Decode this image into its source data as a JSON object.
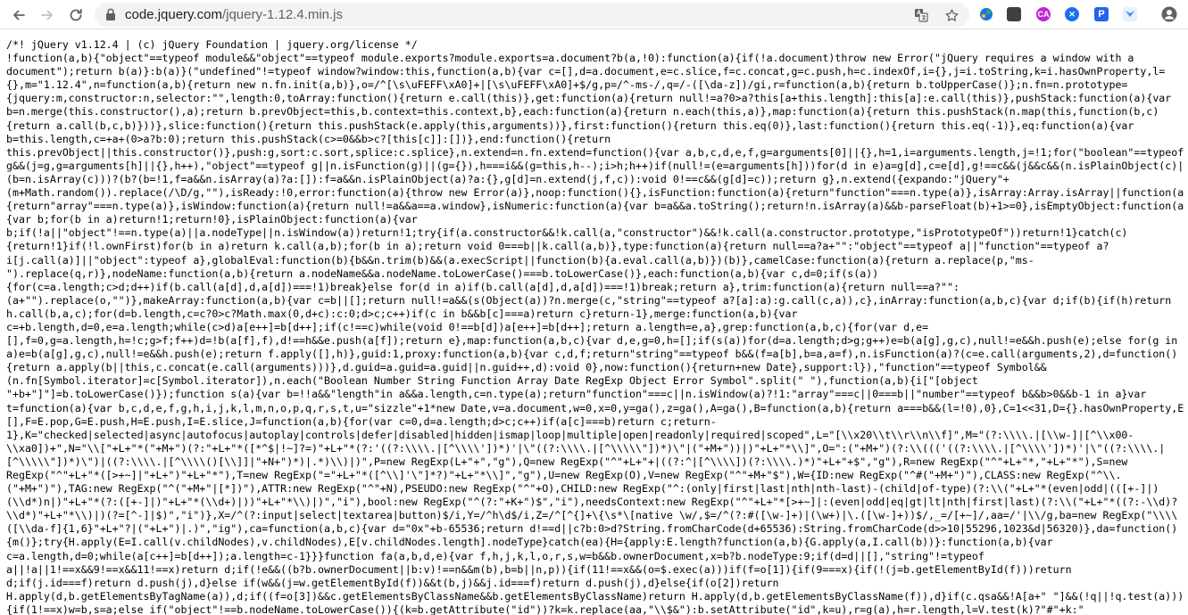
{
  "browser": {
    "url_host": "code.jquery.com",
    "url_path": "/jquery-1.12.4.min.js",
    "extensions": [
      {
        "name": "ext-colorpicker",
        "color": "#1a73e8",
        "label": ""
      },
      {
        "name": "ext-dark",
        "color": "#3c4043",
        "label": ""
      },
      {
        "name": "ext-ca",
        "color": "#c026d3",
        "label": "CA"
      },
      {
        "name": "ext-x",
        "color": "#1a73e8",
        "label": "✕"
      },
      {
        "name": "ext-p",
        "color": "#2563eb",
        "label": "P"
      },
      {
        "name": "ext-bird",
        "color": "#e8f0fe",
        "label": ""
      }
    ]
  },
  "code": {
    "lines": [
      "/*! jQuery v1.12.4 | (c) jQuery Foundation | jquery.org/license */",
      "!function(a,b){\"object\"==typeof module&&\"object\"==typeof module.exports?module.exports=a.document?b(a,!0):function(a){if(!a.document)throw new Error(\"jQuery requires a window with a",
      "document\");return b(a)}:b(a)}(\"undefined\"!=typeof window?window:this,function(a,b){var c=[],d=a.document,e=c.slice,f=c.concat,g=c.push,h=c.indexOf,i={},j=i.toString,k=i.hasOwnProperty,l=",
      "{},m=\"1.12.4\",n=function(a,b){return new n.fn.init(a,b)},o=/^[\\s\\uFEFF\\xA0]+|[\\s\\uFEFF\\xA0]+$/g,p=/^-ms-/,q=/-([\\da-z])/gi,r=function(a,b){return b.toUpperCase()};n.fn=n.prototype=",
      "{jquery:m,constructor:n,selector:\"\",length:0,toArray:function(){return e.call(this)},get:function(a){return null!=a?0>a?this[a+this.length]:this[a]:e.call(this)},pushStack:function(a){var",
      "b=n.merge(this.constructor(),a);return b.prevObject=this,b.context=this.context,b},each:function(a){return n.each(this,a)},map:function(a){return this.pushStack(n.map(this,function(b,c)",
      "{return a.call(b,c,b)}))},slice:function(){return this.pushStack(e.apply(this,arguments))},first:function(){return this.eq(0)},last:function(){return this.eq(-1)},eq:function(a){var",
      "b=this.length,c=+a+(0>a?b:0);return this.pushStack(c>=0&&b>c?[this[c]]:[])},end:function(){return",
      "this.prevObject||this.constructor()},push:g,sort:c.sort,splice:c.splice},n.extend=n.fn.extend=function(){var a,b,c,d,e,f,g=arguments[0]||{},h=1,i=arguments.length,j=!1;for(\"boolean\"==typeof",
      "g&&(j=g,g=arguments[h]||{},h++),\"object\"==typeof g||n.isFunction(g)||(g={}),h===i&&(g=this,h--);i>h;h++)if(null!=(e=arguments[h]))for(d in e)a=g[d],c=e[d],g!==c&&(j&&c&&(n.isPlainObject(c)|",
      "(b=n.isArray(c)))?(b?(b=!1,f=a&&n.isArray(a)?a:[]):f=a&&n.isPlainObject(a)?a:{},g[d]=n.extend(j,f,c)):void 0!==c&&(g[d]=c));return g},n.extend({expando:\"jQuery\"+",
      "(m+Math.random()).replace(/\\D/g,\"\"),isReady:!0,error:function(a){throw new Error(a)},noop:function(){},isFunction:function(a){return\"function\"===n.type(a)},isArray:Array.isArray||function(a)",
      "{return\"array\"===n.type(a)},isWindow:function(a){return null!=a&&a==a.window},isNumeric:function(a){var b=a&&a.toString();return!n.isArray(a)&&b-parseFloat(b)+1>=0},isEmptyObject:function(a)",
      "{var b;for(b in a)return!1;return!0},isPlainObject:function(a){var",
      "b;if(!a||\"object\"!==n.type(a)||a.nodeType||n.isWindow(a))return!1;try{if(a.constructor&&!k.call(a,\"constructor\")&&!k.call(a.constructor.prototype,\"isPrototypeOf\"))return!1}catch(c)",
      "{return!1}if(!l.ownFirst)for(b in a)return k.call(a,b);for(b in a);return void 0===b||k.call(a,b)},type:function(a){return null==a?a+\"\":\"object\"==typeof a||\"function\"==typeof a?",
      "i[j.call(a)]||\"object\":typeof a},globalEval:function(b){b&&n.trim(b)&&(a.execScript||function(b){a.eval.call(a,b)})(b)},camelCase:function(a){return a.replace(p,\"ms-",
      "\").replace(q,r)},nodeName:function(a,b){return a.nodeName&&a.nodeName.toLowerCase()===b.toLowerCase()},each:function(a,b){var c,d=0;if(s(a))",
      "{for(c=a.length;c>d;d++)if(b.call(a[d],d,a[d])===!1)break}else for(d in a)if(b.call(a[d],d,a[d])===!1)break;return a},trim:function(a){return null==a?\"\":",
      "(a+\"\").replace(o,\"\")},makeArray:function(a,b){var c=b||[];return null!=a&&(s(Object(a))?n.merge(c,\"string\"==typeof a?[a]:a):g.call(c,a)),c},inArray:function(a,b,c){var d;if(b){if(h)return",
      "h.call(b,a,c);for(d=b.length,c=c?0>c?Math.max(0,d+c):c:0;d>c;c++)if(c in b&&b[c]===a)return c}return-1},merge:function(a,b){var",
      "c=+b.length,d=0,e=a.length;while(c>d)a[e++]=b[d++];if(c!==c)while(void 0!==b[d])a[e++]=b[d++];return a.length=e,a},grep:function(a,b,c){for(var d,e=",
      "[],f=0,g=a.length,h=!c;g>f;f++)d=!b(a[f],f),d!==h&&e.push(a[f]);return e},map:function(a,b,c){var d,e,g=0,h=[];if(s(a))for(d=a.length;d>g;g++)e=b(a[g],g,c),null!=e&&h.push(e);else for(g in",
      "a)e=b(a[g],g,c),null!=e&&h.push(e);return f.apply([],h)},guid:1,proxy:function(a,b){var c,d,f;return\"string\"==typeof b&&(f=a[b],b=a,a=f),n.isFunction(a)?(c=e.call(arguments,2),d=function()",
      "{return a.apply(b||this,c.concat(e.call(arguments)))},d.guid=a.guid=a.guid||n.guid++,d):void 0},now:function(){return+new Date},support:l}),\"function\"==typeof Symbol&&",
      "(n.fn[Symbol.iterator]=c[Symbol.iterator]),n.each(\"Boolean Number String Function Array Date RegExp Object Error Symbol\".split(\" \"),function(a,b){i[\"[object",
      "\"+b+\"]\"]=b.toLowerCase()});function s(a){var b=!!a&&\"length\"in a&&a.length,c=n.type(a);return\"function\"===c||n.isWindow(a)?!1:\"array\"===c||0===b||\"number\"==typeof b&&b>0&&b-1 in a}var",
      "t=function(a){var b,c,d,e,f,g,h,i,j,k,l,m,n,o,p,q,r,s,t,u=\"sizzle\"+1*new Date,v=a.document,w=0,x=0,y=ga(),z=ga(),A=ga(),B=function(a,b){return a===b&&(l=!0),0},C=1<<31,D={}.hasOwnProperty,E=",
      "[],F=E.pop,G=E.push,H=E.push,I=E.slice,J=function(a,b){for(var c=0,d=a.length;d>c;c++)if(a[c]===b)return c;return-",
      "1},K=\"checked|selected|async|autofocus|autoplay|controls|defer|disabled|hidden|ismap|loop|multiple|open|readonly|required|scoped\",L=\"[\\\\x20\\\\t\\\\r\\\\n\\\\f]\",M=\"(?:\\\\\\\\.|[\\\\w-]|[^\\\\x00-",
      "\\\\xa0])+\",N=\"\\\\[\"+L+\"*(\"+M+\")(?:\"+L+\"*([*^$|!~]?=)\"+L+\"*(?:'((?:\\\\\\\\.|[^\\\\\\\\'])*)'|\\\"((?:\\\\\\\\.|[^\\\\\\\\\\\"])*)\\\"|(\"+M+\"))|)\"+L+\"*\\\\]\",O=\":(\"+M+\")(?:\\\\((('((?:\\\\\\\\.|[^\\\\\\\\'])*)'|\\\"((?:\\\\\\\\.|",
      "[^\\\\\\\\\\\"])*)\\\")|((?:\\\\\\\\.|[^\\\\\\\\()[\\\\]]|\"+N+\")*)|.*)\\\\)|)\",P=new RegExp(L+\"+\",\"g\"),Q=new RegExp(\"^\"+L+\"+|((?:^|[^\\\\\\\\])(?:\\\\\\\\.)*)\"+L+\"+$\",\"g\"),R=new RegExp(\"^\"+L+\"*,\"+L+\"*\"),S=new",
      "RegExp(\"^\"+L+\"*([>+~]|\"+L+\")\"+L+\"*\"),T=new RegExp(\"=\"+L+\"*([^\\\\]'\\\"]*?)\"+L+\"*\\\\]\",\"g\"),U=new RegExp(O),V=new RegExp(\"^\"+M+\"$\"),W={ID:new RegExp(\"^#(\"+M+\")\"),CLASS:new RegExp(\"^\\\\.",
      "(\"+M+\")\"),TAG:new RegExp(\"^(\"+M+\"|[*])\"),ATTR:new RegExp(\"^\"+N),PSEUDO:new RegExp(\"^\"+O),CHILD:new RegExp(\"^:(only|first|last|nth|nth-last)-(child|of-type)(?:\\\\(\"+L+\"*(even|odd|(([+-]|)",
      "(\\\\d*)n|)\"+L+\"*(?:([+-]|)\"+L+\"*(\\\\d+)|))\"+L+\"*\\\\)|)\",\"i\"),bool:new RegExp(\"^(?:\"+K+\")$\",\"i\"),needsContext:new RegExp(\"^\"+L+\"*[>+~]|:(even|odd|eq|gt|lt|nth|first|last)(?:\\\\(\"+L+\"*((?:-\\\\d)?",
      "\\\\d*)\"+L+\"*\\\\)|)(?=[^-]|$)\",\"i\")},X=/^(?:input|select|textarea|button)$/i,Y=/^h\\d$/i,Z=/^[^{]+\\{\\s*\\[native \\w/,$=/^(?:#([\\w-]+)|(\\w+)|\\.([\\w-]+))$/,_=/[+~]/,aa=/'|\\\\/g,ba=new RegExp(\"\\\\\\\\",
      "([\\\\da-f]{1,6}\"+L+\"?|(\"+L+\")|.)\",\"ig\"),ca=function(a,b,c){var d=\"0x\"+b-65536;return d!==d||c?b:0>d?String.fromCharCode(d+65536):String.fromCharCode(d>>10|55296,1023&d|56320)},da=function()",
      "{m()};try{H.apply(E=I.call(v.childNodes),v.childNodes),E[v.childNodes.length].nodeType}catch(ea){H={apply:E.length?function(a,b){G.apply(a,I.call(b))}:function(a,b){var",
      "c=a.length,d=0;while(a[c++]=b[d++]);a.length=c-1}}}function fa(a,b,d,e){var f,h,j,k,l,o,r,s,w=b&&b.ownerDocument,x=b?b.nodeType:9;if(d=d||[],\"string\"!=typeof",
      "a||!a||1!==x&&9!==x&&11!==x)return d;if(!e&&((b?b.ownerDocument||b:v)!==n&&m(b),b=b||n,p)){if(11!==x&&(o=$.exec(a)))if(f=o[1]){if(9===x){if(!(j=b.getElementById(f)))return",
      "d;if(j.id===f)return d.push(j),d}else if(w&&(j=w.getElementById(f))&&t(b,j)&&j.id===f)return d.push(j),d}else{if(o[2])return",
      "H.apply(d,b.getElementsByTagName(a)),d;if((f=o[3])&&c.getElementsByClassName&&b.getElementsByClassName)return H.apply(d,b.getElementsByClassName(f)),d}if(c.qsa&&!A[a+\" \"]&&(!q||!q.test(a)))",
      "{if(1!==x)w=b,s=a;else if(\"object\"!==b.nodeName.toLowerCase()){(k=b.getAttribute(\"id\"))?k=k.replace(aa,\"\\\\$&\"):b.setAttribute(\"id\",k=u),r=g(a),h=r.length,l=V.test(k)?\"#\"+k:\""
    ]
  }
}
